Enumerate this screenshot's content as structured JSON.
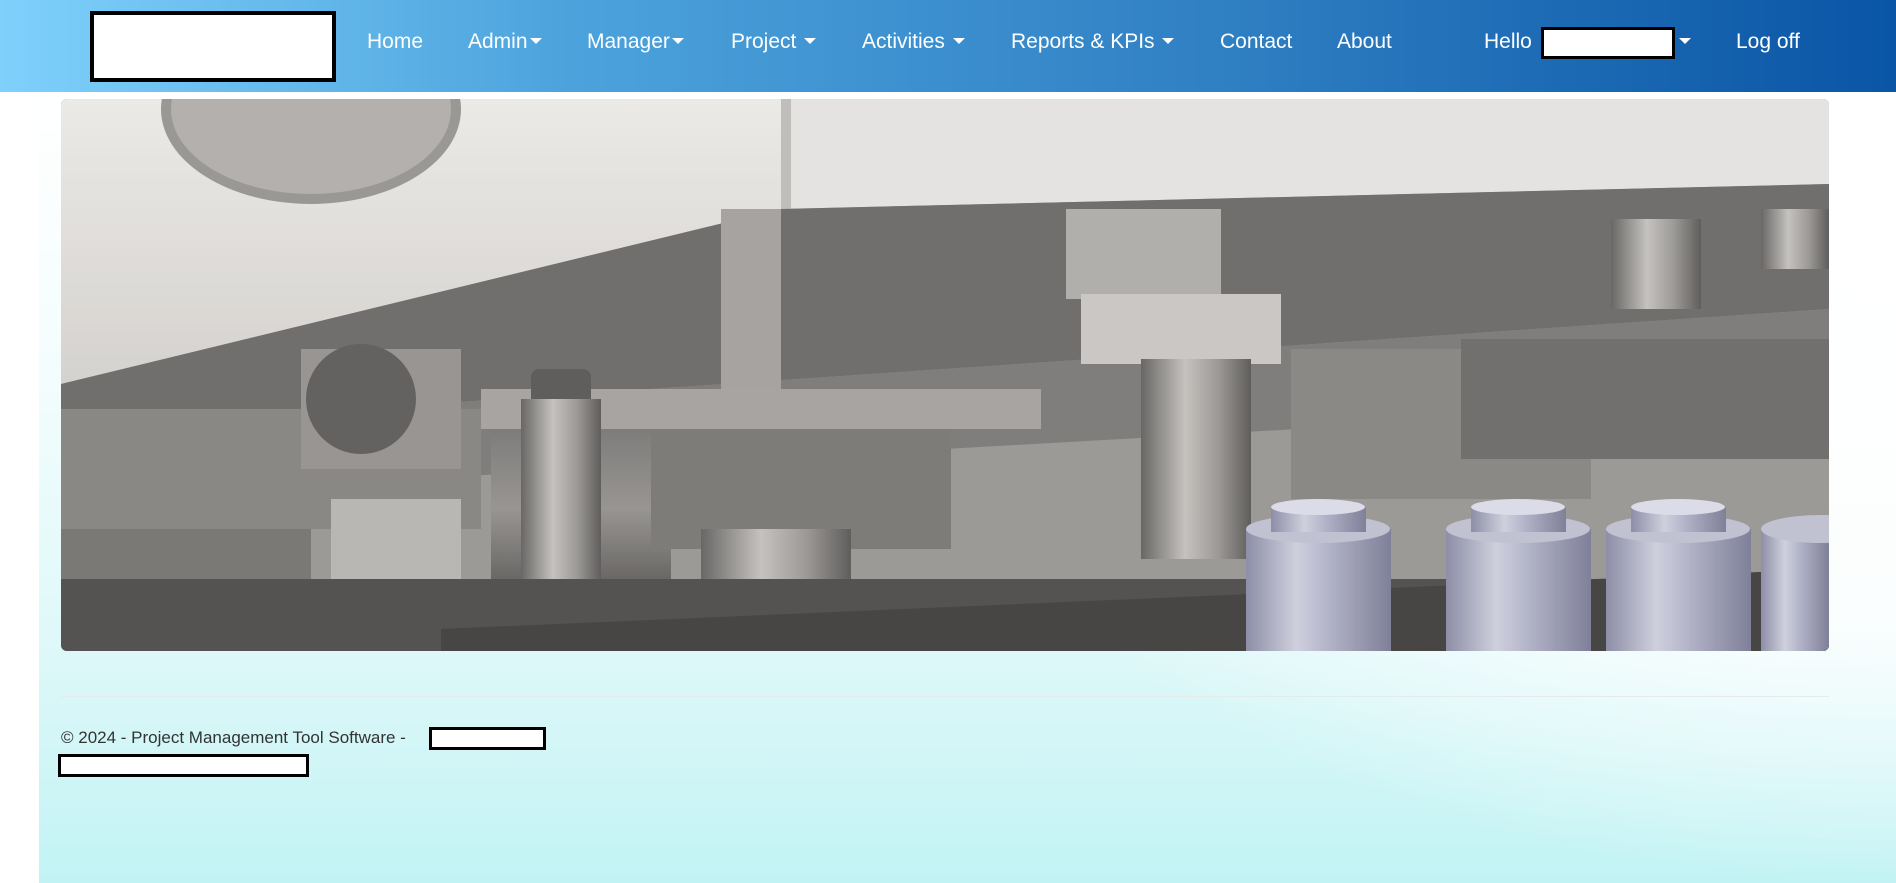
{
  "navbar": {
    "items": [
      {
        "label": "Home",
        "dropdown": false
      },
      {
        "label": "Admin",
        "dropdown": true
      },
      {
        "label": "Manager",
        "dropdown": true
      },
      {
        "label": "Project",
        "dropdown": true
      },
      {
        "label": "Activities",
        "dropdown": true
      },
      {
        "label": "Reports & KPIs",
        "dropdown": true
      },
      {
        "label": "Contact",
        "dropdown": false
      },
      {
        "label": "About",
        "dropdown": false
      }
    ],
    "greeting": "Hello",
    "logoff_label": "Log off"
  },
  "hero": {
    "icon": "industrial-machinery-image"
  },
  "footer": {
    "copyright": "© 2024 - Project Management Tool Software -"
  },
  "colors": {
    "navbar_start": "#7fd0fb",
    "navbar_end": "#0a55a5",
    "nav_text": "#ffffff",
    "footer_text": "#333333"
  }
}
